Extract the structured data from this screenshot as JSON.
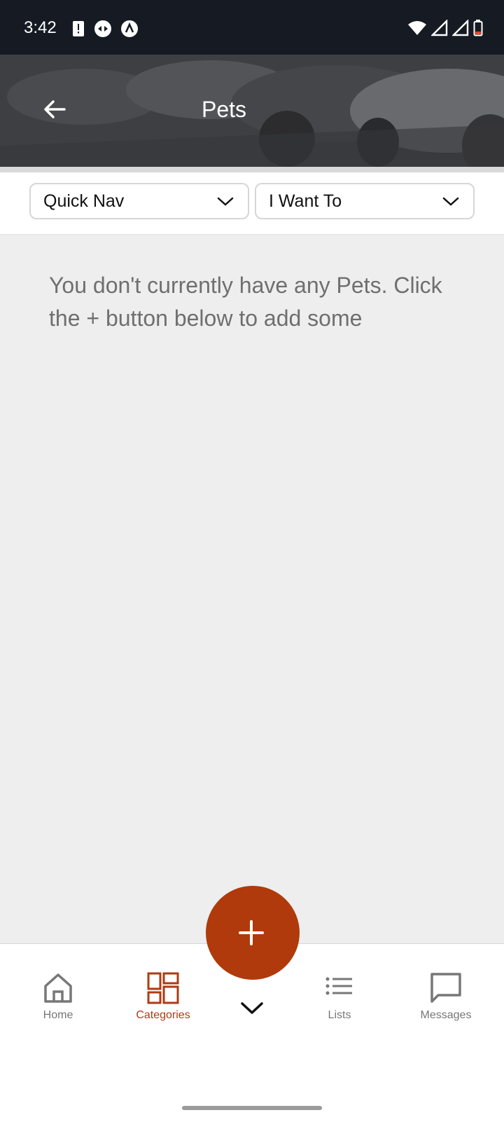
{
  "status_bar": {
    "time": "3:42",
    "left_icons": [
      "alert-icon",
      "data-saver-icon",
      "vpn-icon"
    ],
    "right_icons": [
      "wifi-icon",
      "signal-icon",
      "signal-icon",
      "battery-icon"
    ]
  },
  "header": {
    "title": "Pets",
    "back_icon": "arrow-left-icon"
  },
  "toolbar": {
    "quick_nav_label": "Quick Nav",
    "i_want_to_label": "I Want To"
  },
  "main": {
    "empty_message": "You don't currently have any Pets. Click the + button below to add some"
  },
  "bottom_nav": {
    "items": [
      {
        "label": "Home",
        "icon": "home-icon",
        "active": false
      },
      {
        "label": "Categories",
        "icon": "categories-icon",
        "active": true
      },
      {
        "label": "Lists",
        "icon": "list-icon",
        "active": false
      },
      {
        "label": "Messages",
        "icon": "message-icon",
        "active": false
      }
    ]
  },
  "fab": {
    "icon": "plus-icon"
  },
  "colors": {
    "accent": "#b03a0b",
    "status_bar_bg": "#151a23",
    "content_bg": "#eeeeee",
    "inactive_nav": "#777777"
  }
}
